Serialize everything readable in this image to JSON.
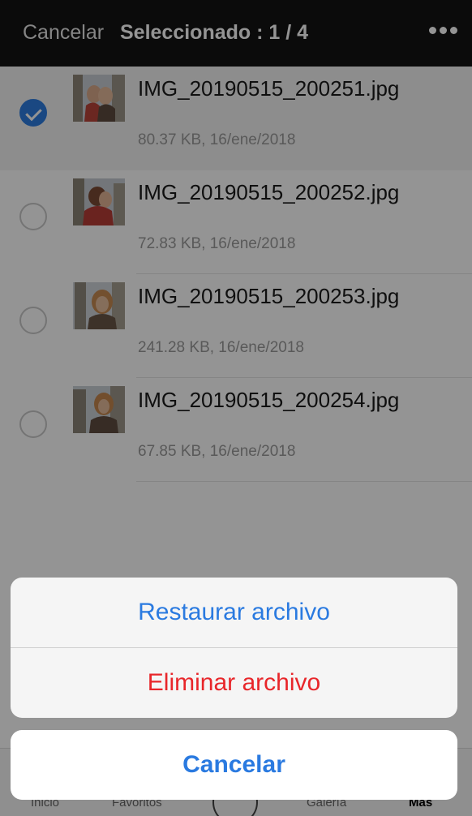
{
  "header": {
    "cancel_label": "Cancelar",
    "title": "Seleccionado : 1 / 4"
  },
  "files": [
    {
      "name": "IMG_20190515_200251.jpg",
      "meta": "80.37 KB, 16/ene/2018",
      "selected": true
    },
    {
      "name": "IMG_20190515_200252.jpg",
      "meta": "72.83 KB, 16/ene/2018",
      "selected": false
    },
    {
      "name": "IMG_20190515_200253.jpg",
      "meta": "241.28 KB, 16/ene/2018",
      "selected": false
    },
    {
      "name": "IMG_20190515_200254.jpg",
      "meta": "67.85 KB, 16/ene/2018",
      "selected": false
    }
  ],
  "tabs": {
    "inicio": "Inicio",
    "favoritos": "Favoritos",
    "galeria": "Galería",
    "mas": "Más"
  },
  "action_sheet": {
    "restore_label": "Restaurar archivo",
    "delete_label": "Eliminar archivo",
    "cancel_label": "Cancelar"
  },
  "colors": {
    "accent": "#2a7ae0",
    "destructive": "#e8262a",
    "header_bg": "#141414"
  }
}
